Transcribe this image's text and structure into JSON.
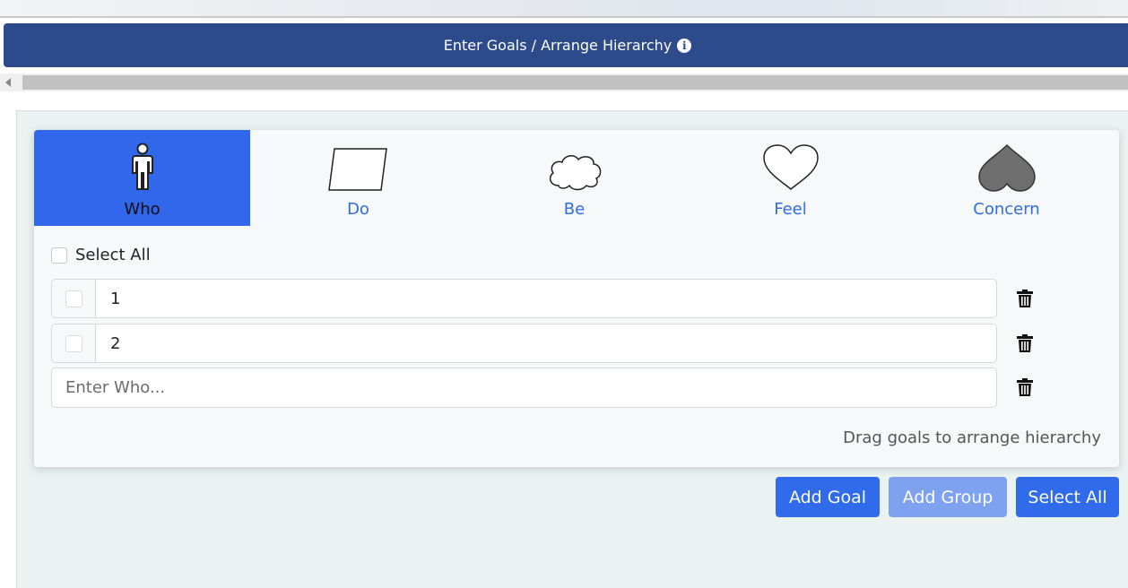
{
  "header": {
    "title": "Enter Goals / Arrange Hierarchy",
    "info_glyph": "i"
  },
  "tabs": [
    {
      "label": "Who",
      "icon": "person-icon",
      "active": true
    },
    {
      "label": "Do",
      "icon": "parallelogram-icon",
      "active": false
    },
    {
      "label": "Be",
      "icon": "cloud-icon",
      "active": false
    },
    {
      "label": "Feel",
      "icon": "heart-icon",
      "active": false
    },
    {
      "label": "Concern",
      "icon": "inverted-heart-icon",
      "active": false
    }
  ],
  "select_all_label": "Select All",
  "goals": [
    {
      "value": "1"
    },
    {
      "value": "2"
    }
  ],
  "new_goal": {
    "placeholder": "Enter Who..."
  },
  "hint": "Drag goals to arrange hierarchy",
  "buttons": {
    "add_goal": "Add Goal",
    "add_group": "Add Group",
    "select_all": "Select All"
  },
  "colors": {
    "header_bg": "#2d4a8a",
    "accent": "#2f6bea",
    "active_tab": "#3167ea",
    "disabled_button": "#7fa2f0"
  }
}
